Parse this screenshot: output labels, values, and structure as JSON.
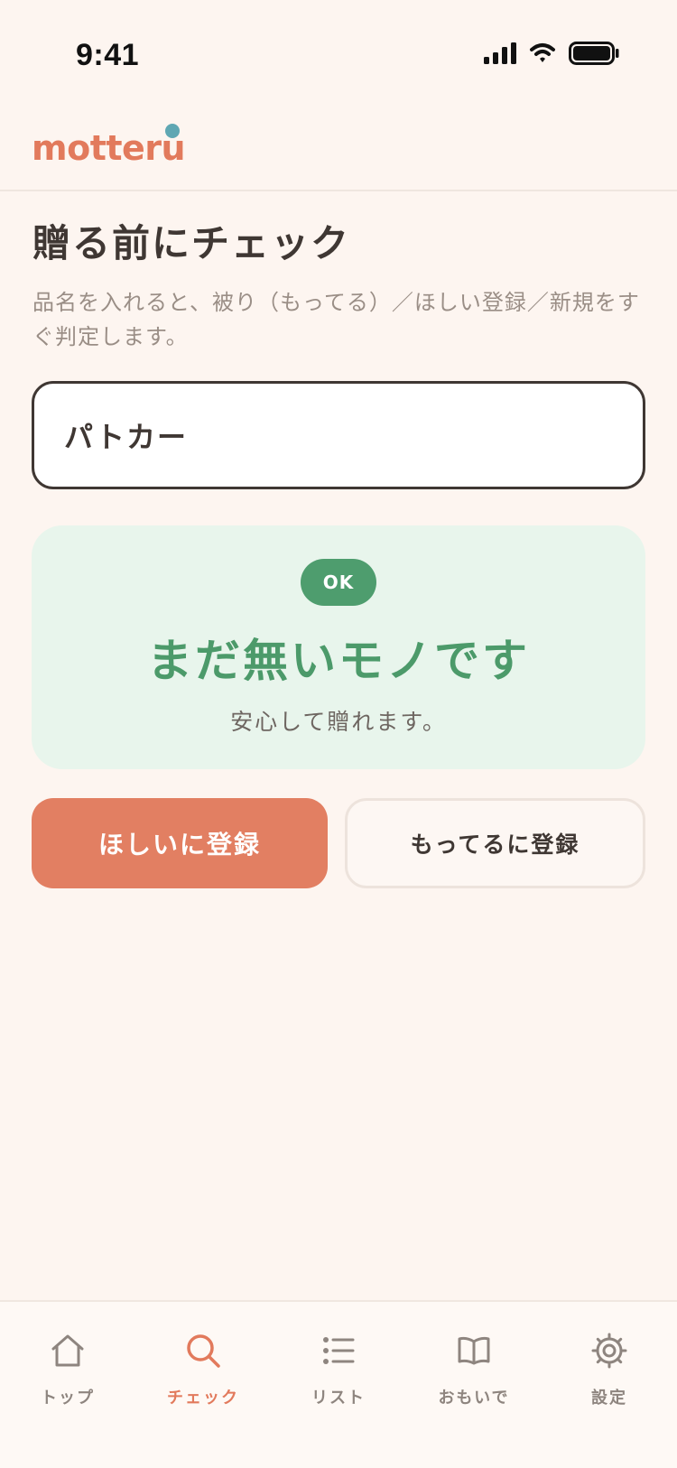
{
  "status_bar": {
    "time": "9:41"
  },
  "header": {
    "logo": "motteru"
  },
  "main": {
    "title": "贈る前にチェック",
    "description": "品名を入れると、被り（もってる）／ほしい登録／新規をすぐ判定します。",
    "input": {
      "value": "パトカー",
      "placeholder": ""
    },
    "result": {
      "badge": "OK",
      "title": "まだ無いモノです",
      "subtitle": "安心して贈れます。",
      "accent_color": "#4C9A6A"
    },
    "actions": {
      "want_label": "ほしいに登録",
      "have_label": "もってるに登録"
    }
  },
  "tabs": [
    {
      "label": "トップ",
      "icon": "home-icon",
      "active": false
    },
    {
      "label": "チェック",
      "icon": "search-icon",
      "active": true
    },
    {
      "label": "リスト",
      "icon": "list-icon",
      "active": false
    },
    {
      "label": "おもいで",
      "icon": "book-icon",
      "active": false
    },
    {
      "label": "設定",
      "icon": "gear-icon",
      "active": false
    }
  ],
  "colors": {
    "brand": "#E27A5C",
    "background": "#FDF5F0",
    "success": "#4E9D6E",
    "logo_dot": "#5FA7B3"
  }
}
